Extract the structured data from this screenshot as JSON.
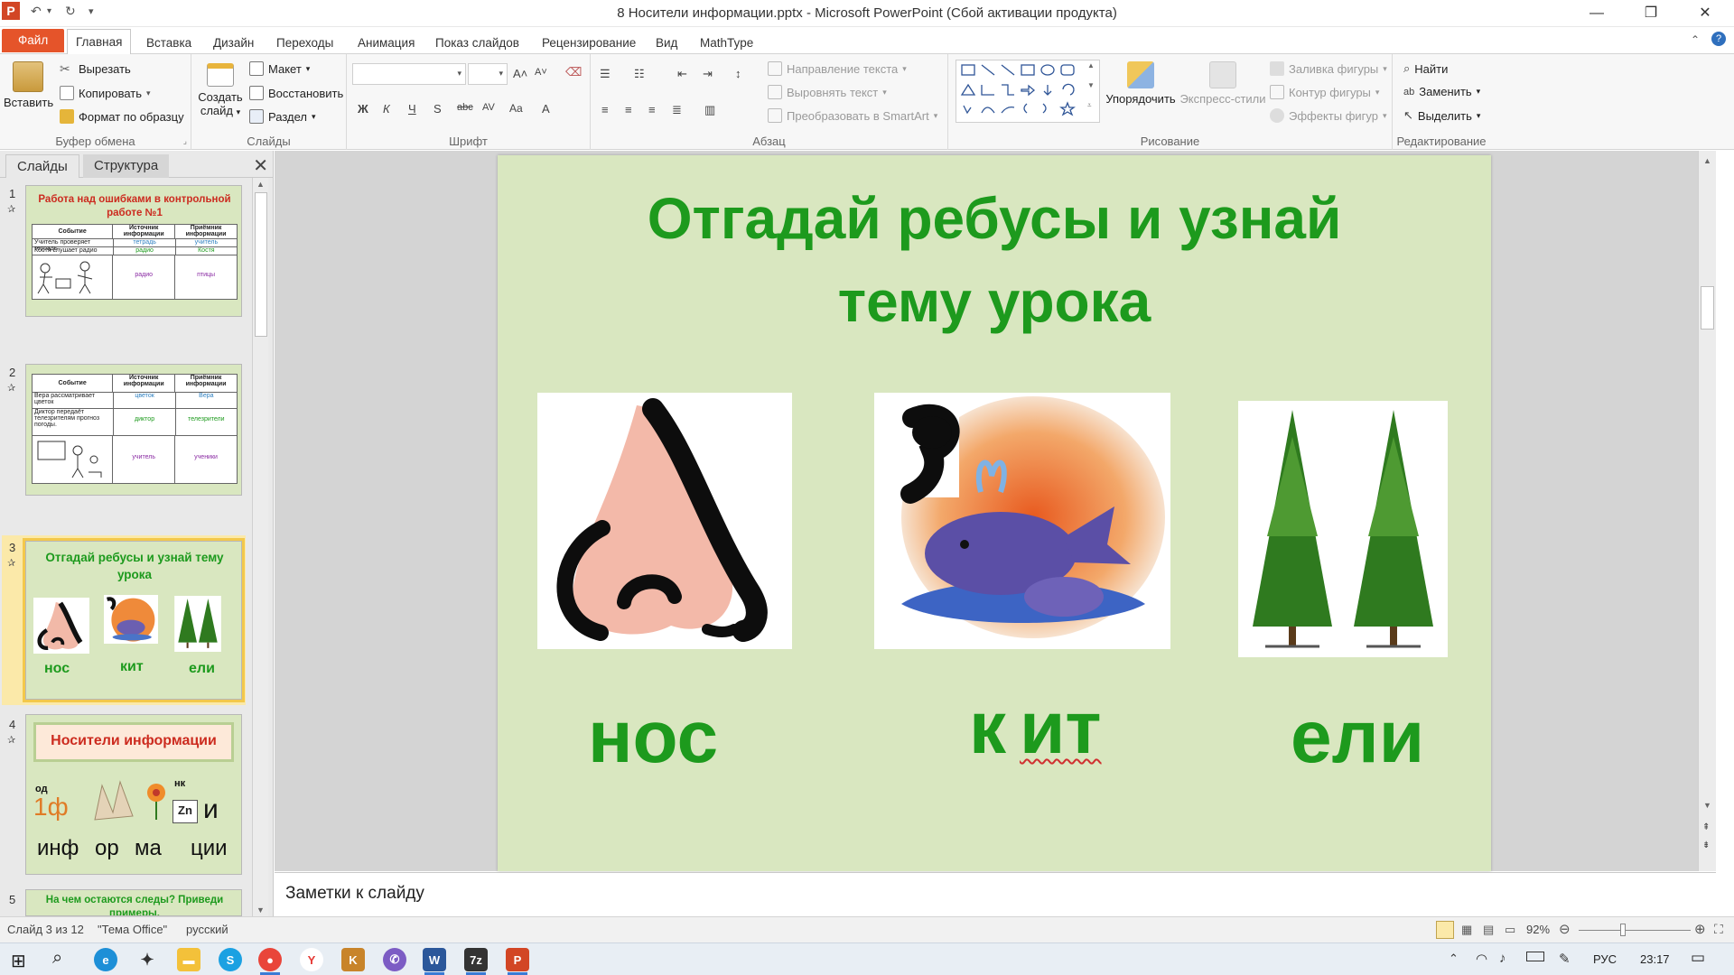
{
  "window": {
    "title": "8 Носители информации.pptx  -  Microsoft PowerPoint (Сбой активации продукта)",
    "minimize": "—",
    "maximize": "❐",
    "close": "✕"
  },
  "tabs": [
    "Файл",
    "Главная",
    "Вставка",
    "Дизайн",
    "Переходы",
    "Анимация",
    "Показ слайдов",
    "Рецензирование",
    "Вид",
    "MathType"
  ],
  "active_tab": "Главная",
  "ribbon": {
    "clipboard": {
      "title": "Буфер обмена",
      "paste": "Вставить",
      "cut": "Вырезать",
      "copy": "Копировать",
      "format_painter": "Формат по образцу"
    },
    "slides": {
      "title": "Слайды",
      "new_slide_line1": "Создать",
      "new_slide_line2": "слайд",
      "layout": "Макет",
      "reset": "Восстановить",
      "section": "Раздел"
    },
    "font": {
      "title": "Шрифт"
    },
    "paragraph": {
      "title": "Абзац",
      "text_direction": "Направление текста",
      "align_text": "Выровнять текст",
      "smartart": "Преобразовать в SmartArt"
    },
    "drawing": {
      "title": "Рисование",
      "arrange": "Упорядочить",
      "quick_styles": "Экспресс-стили",
      "shape_fill": "Заливка фигуры",
      "shape_outline": "Контур фигуры",
      "shape_effects": "Эффекты фигур"
    },
    "editing": {
      "title": "Редактирование",
      "find": "Найти",
      "replace": "Заменить",
      "select": "Выделить"
    }
  },
  "left_panel": {
    "tabs": [
      "Слайды",
      "Структура"
    ],
    "close": "✕",
    "thumbnails": [
      {
        "num": "1",
        "title": "Работа  над ошибками  в контрольной работе №1",
        "headers": [
          "Событие",
          "Источник информации",
          "Приёмник информации"
        ],
        "rows": [
          [
            "Учитель проверяет тетрадь",
            "тетрадь",
            "учитель"
          ],
          [
            "Костя слушает радио",
            "радио",
            "Костя"
          ],
          [
            "",
            "радио",
            "птицы"
          ]
        ]
      },
      {
        "num": "2",
        "headers": [
          "Событие",
          "Источник информации",
          "Приёмник информации"
        ],
        "rows": [
          [
            "Вера рассматривает цветок",
            "цветок",
            "Вера"
          ],
          [
            "Диктор передаёт телезрителям прогноз погоды.",
            "диктор",
            "телезрители"
          ],
          [
            "",
            "учитель",
            "ученики"
          ]
        ]
      },
      {
        "num": "3",
        "title": "Отгадай ребусы и узнай тему урока",
        "words": [
          "нос",
          "кит",
          "ели"
        ]
      },
      {
        "num": "4",
        "title": "Носители  информации",
        "labels": [
          "од",
          "нк",
          "Zn",
          "1ф",
          "и"
        ],
        "syllables": [
          "инф",
          "ор",
          "ма",
          "ции"
        ]
      },
      {
        "num": "5",
        "title": "На чем остаются следы? Приведи примеры."
      }
    ]
  },
  "slide": {
    "title_line1": "Отгадай ребусы и узнай",
    "title_line2": "тему урока",
    "words": [
      "нос",
      "к",
      "ит",
      "ели"
    ]
  },
  "notes": {
    "placeholder": "Заметки к слайду"
  },
  "status": {
    "slide_info": "Слайд 3 из 12",
    "theme": "\"Тема Office\"",
    "language": "русский",
    "zoom": "92%"
  },
  "taskbar": {
    "lang": "РУС",
    "time": "23:17"
  },
  "colors": {
    "accent": "#e5542a",
    "slide_bg": "#d9e7c0",
    "slide_title": "#1d9a1d",
    "thumb1_title": "#cc2b1f"
  }
}
